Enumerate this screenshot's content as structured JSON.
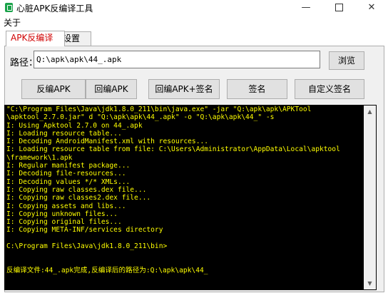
{
  "window": {
    "title": "心脏APK反编译工具",
    "minimize_glyph": "—",
    "close_glyph": "✕"
  },
  "menu": {
    "about": "关于"
  },
  "tabs": [
    {
      "label": "APK反编译"
    },
    {
      "label": "设置"
    }
  ],
  "path": {
    "label": "路径：",
    "value": "Q:\\apk\\apk\\44_.apk"
  },
  "buttons": {
    "browse": "浏览",
    "decompile": "反编APK",
    "recompile": "回编APK",
    "recompile_sign": "回编APK+签名",
    "sign": "签名",
    "custom_sign": "自定义签名"
  },
  "console": {
    "lines": [
      "\"C:\\Program Files\\Java\\jdk1.8.0_211\\bin\\java.exe\" -jar \"Q:\\apk\\apk\\APKTool",
      "\\apktool_2.7.0.jar\" d \"Q:\\apk\\apk\\44_.apk\" -o \"Q:\\apk\\apk\\44_\" -s",
      "I: Using Apktool 2.7.0 on 44_.apk",
      "I: Loading resource table...",
      "I: Decoding AndroidManifest.xml with resources...",
      "I: Loading resource table from file: C:\\Users\\Administrator\\AppData\\Local\\apktool",
      "\\framework\\1.apk",
      "I: Regular manifest package...",
      "I: Decoding file-resources...",
      "I: Decoding values */* XMLs...",
      "I: Copying raw classes.dex file...",
      "I: Copying raw classes2.dex file...",
      "I: Copying assets and libs...",
      "I: Copying unknown files...",
      "I: Copying original files...",
      "I: Copying META-INF/services directory",
      "",
      "C:\\Program Files\\Java\\jdk1.8.0_211\\bin>",
      "",
      "",
      "反编译文件:44_.apk完成,反编译后的路径为:Q:\\apk\\apk\\44_"
    ]
  },
  "scrollbar": {
    "up_glyph": "▲",
    "down_glyph": "▼"
  }
}
